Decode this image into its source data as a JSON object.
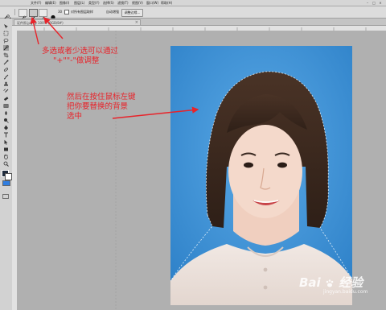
{
  "menu": {
    "items": [
      "文件(F)",
      "编辑(E)",
      "图像(I)",
      "图层(L)",
      "类型(Y)",
      "选择(S)",
      "滤镜(T)",
      "视图(V)",
      "窗口(W)",
      "帮助(H)"
    ],
    "window_controls": [
      "–",
      "□",
      "×"
    ]
  },
  "options": {
    "refine_edge_label": "调整边缘...",
    "auto_enhance_label": "自动增强",
    "sample_all_layers_label": "对所有图层取样",
    "brush_size": "30"
  },
  "document": {
    "tab_title": "证件照.jpg @ 100% (RGB/8#)"
  },
  "annotations": {
    "line1": "多选或者少选可以通过",
    "line2": "\"+\"\"-\"做调整",
    "line3": "然后在按住鼠标左键",
    "line4": "把你要替换的背景",
    "line5": "选中"
  },
  "watermark": {
    "brand": "Bai",
    "brand2": "经验",
    "domain": "jingyan.baidu.com"
  },
  "colors": {
    "annotation_red": "#e8232a",
    "photo_background_blue": "#3f93d6"
  }
}
